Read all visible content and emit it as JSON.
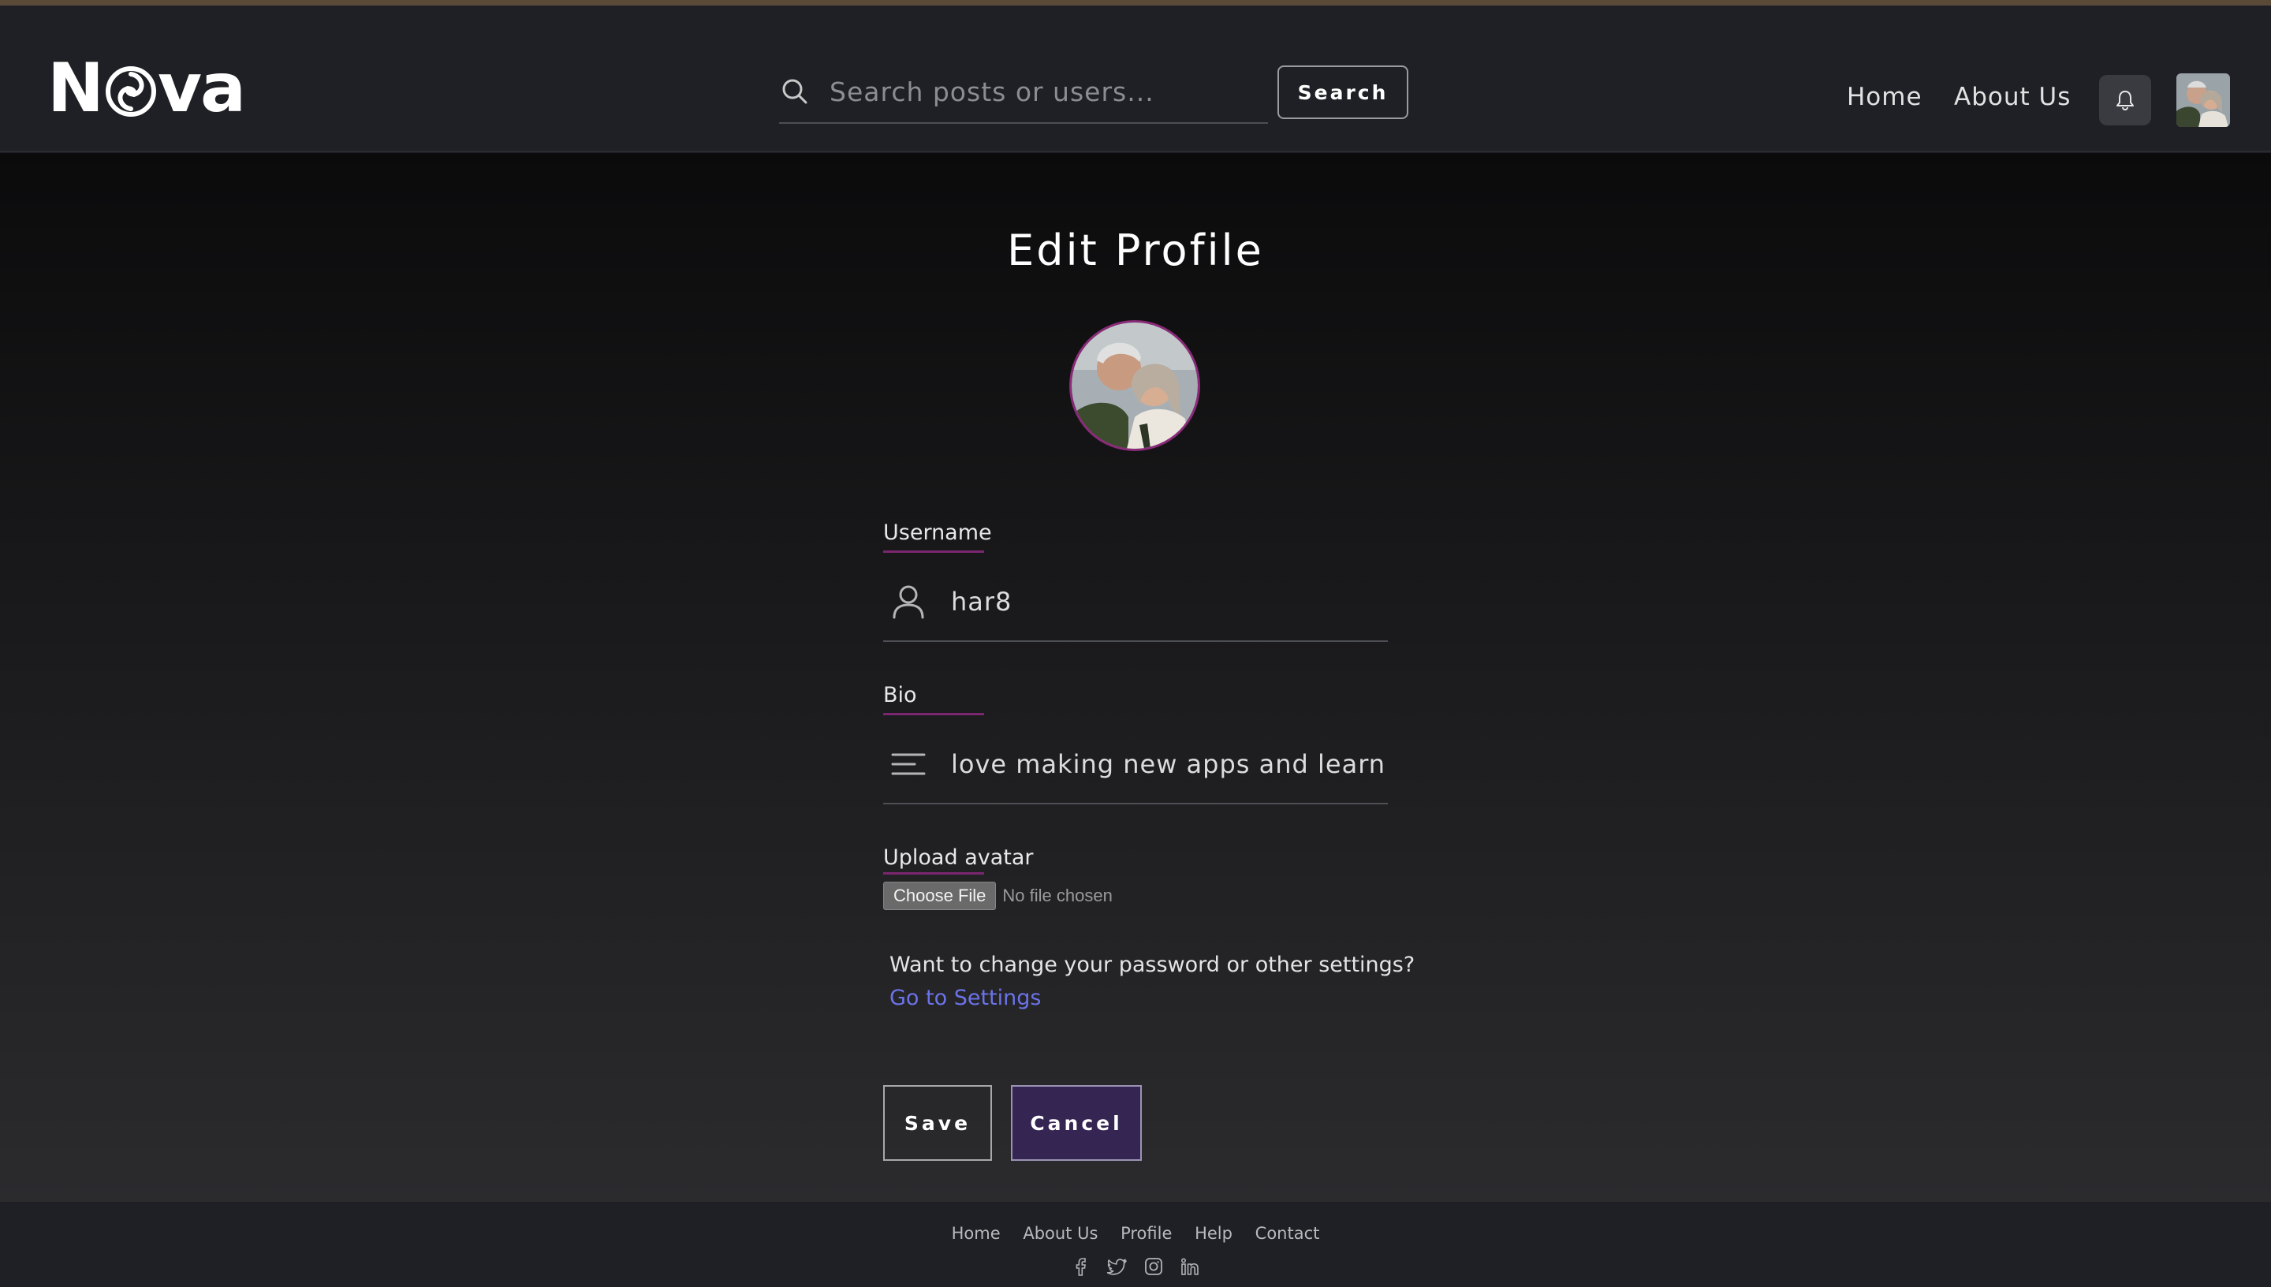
{
  "header": {
    "logo": "Nova",
    "search": {
      "placeholder": "Search posts or users...",
      "value": ""
    },
    "search_button": "Search",
    "nav": [
      {
        "label": "Home"
      },
      {
        "label": "About Us"
      }
    ]
  },
  "main": {
    "title": "Edit Profile",
    "username": {
      "label": "Username",
      "value": "har8"
    },
    "bio": {
      "label": "Bio",
      "value": "love making new apps and learning"
    },
    "upload": {
      "label": "Upload avatar",
      "button": "Choose File",
      "status": "No file chosen"
    },
    "settings": {
      "prompt": "Want to change your password or other settings?",
      "link": "Go to Settings"
    },
    "save_label": "Save",
    "cancel_label": "Cancel"
  },
  "footer": {
    "links": [
      "Home",
      "About Us",
      "Profile",
      "Help",
      "Contact"
    ],
    "social": [
      "facebook-icon",
      "twitter-icon",
      "instagram-icon",
      "linkedin-icon"
    ]
  },
  "colors": {
    "accent_underline": "#7b2670",
    "link": "#6b73e8",
    "cancel_bg": "#352552",
    "header_bg": "#1f2025"
  }
}
